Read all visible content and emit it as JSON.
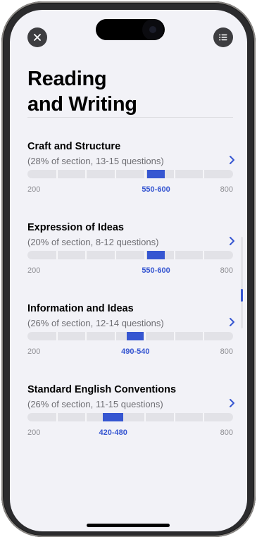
{
  "header": {
    "title": "Reading\nand Writing",
    "close_icon": "close-icon",
    "menu_icon": "list-icon"
  },
  "scale": {
    "min": 200,
    "max": 800,
    "min_label": "200",
    "max_label": "800"
  },
  "sections": [
    {
      "title": "Craft and Structure",
      "subtitle": "(28% of section, 13-15 questions)",
      "range_label": "550-600",
      "range_low": 550,
      "range_high": 600
    },
    {
      "title": "Expression of Ideas",
      "subtitle": "(20% of section, 8-12 questions)",
      "range_label": "550-600",
      "range_low": 550,
      "range_high": 600
    },
    {
      "title": "Information and Ideas",
      "subtitle": "(26% of section, 12-14 questions)",
      "range_label": "490-540",
      "range_low": 490,
      "range_high": 540
    },
    {
      "title": "Standard English Conventions",
      "subtitle": "(26% of section, 11-15 questions)",
      "range_label": "420-480",
      "range_low": 420,
      "range_high": 480
    }
  ],
  "colors": {
    "accent": "#3656d1",
    "track": "#e2e2e7",
    "background": "#f2f2f7"
  }
}
